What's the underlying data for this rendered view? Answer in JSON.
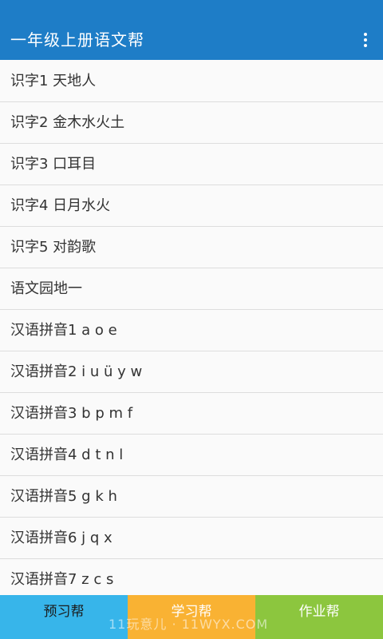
{
  "app_bar": {
    "title": "一年级上册语文帮",
    "menu_icon": "more-vert-icon"
  },
  "lessons": [
    "识字1 天地人",
    "识字2 金木水火土",
    "识字3 口耳目",
    "识字4 日月水火",
    "识字5 对韵歌",
    "语文园地一",
    "汉语拼音1 a o e",
    "汉语拼音2 i u ü y w",
    "汉语拼音3 b p m f",
    "汉语拼音4 d t n l",
    "汉语拼音5 g k h",
    "汉语拼音6 j q x",
    "汉语拼音7 z c s"
  ],
  "tabs": {
    "preview": "预习帮",
    "study": "学习帮",
    "homework": "作业帮"
  },
  "watermark": "11玩意儿 · 11WYX.COM",
  "colors": {
    "primary": "#1e7dc7",
    "tab_preview": "#37b5ea",
    "tab_study": "#f9b233",
    "tab_homework": "#8cc63e"
  }
}
